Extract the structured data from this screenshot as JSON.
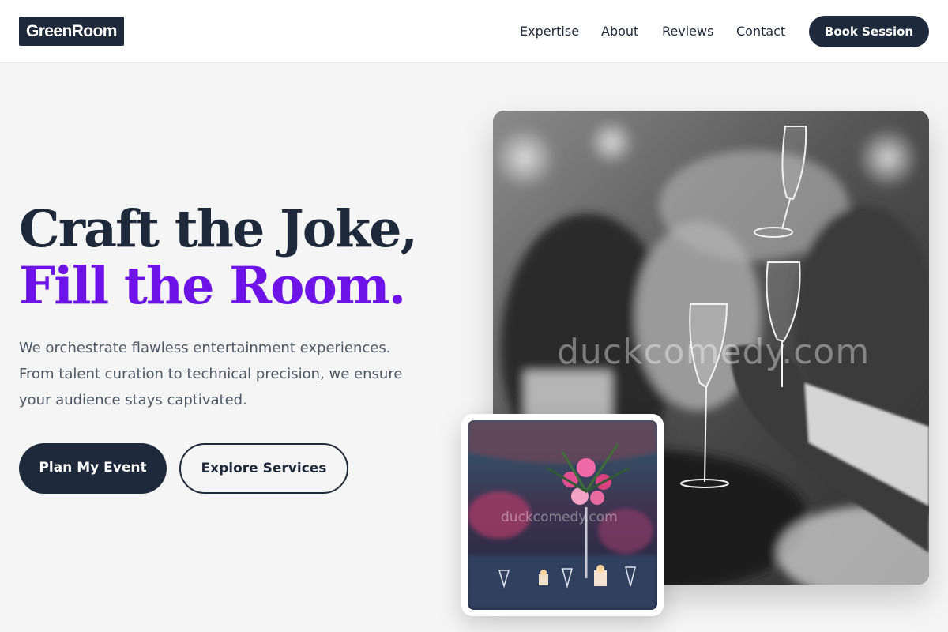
{
  "header": {
    "logo": "GreenRoom",
    "nav": [
      "Expertise",
      "About",
      "Reviews",
      "Contact"
    ],
    "cta": "Book Session"
  },
  "hero": {
    "headline_line1": "Craft the Joke,",
    "headline_line2": "Fill the Room.",
    "lead_line1": "We orchestrate flawless entertainment experiences.",
    "lead_line2": "From talent curation to technical precision, we ensure",
    "lead_line3": "your audience stays captivated.",
    "primary_cta": "Plan My Event",
    "secondary_cta": "Explore Services"
  },
  "images": {
    "main_watermark": "duckcomedy.com",
    "inset_watermark": "duckcomedy.com"
  },
  "colors": {
    "navy": "#1e293b",
    "accent_purple": "#6d13e8",
    "body_text": "#4b5563",
    "background": "#f5f5f6"
  }
}
